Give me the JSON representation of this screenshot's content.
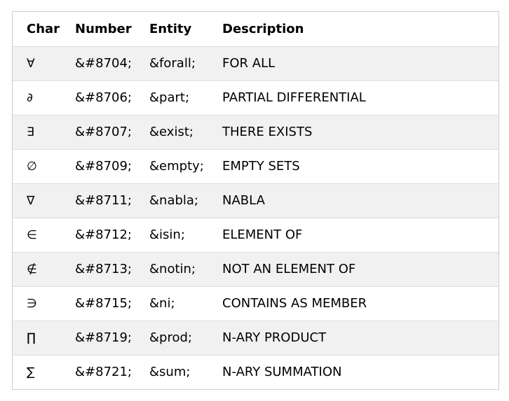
{
  "table": {
    "headers": [
      "Char",
      "Number",
      "Entity",
      "Description"
    ],
    "rows": [
      {
        "char": "∀",
        "number": "&#8704;",
        "entity": "&forall;",
        "description": "FOR ALL"
      },
      {
        "char": "∂",
        "number": "&#8706;",
        "entity": "&part;",
        "description": "PARTIAL DIFFERENTIAL"
      },
      {
        "char": "∃",
        "number": "&#8707;",
        "entity": "&exist;",
        "description": "THERE EXISTS"
      },
      {
        "char": "∅",
        "number": "&#8709;",
        "entity": "&empty;",
        "description": "EMPTY SETS"
      },
      {
        "char": "∇",
        "number": "&#8711;",
        "entity": "&nabla;",
        "description": "NABLA"
      },
      {
        "char": "∈",
        "number": "&#8712;",
        "entity": "&isin;",
        "description": "ELEMENT OF"
      },
      {
        "char": "∉",
        "number": "&#8713;",
        "entity": "&notin;",
        "description": "NOT AN ELEMENT OF"
      },
      {
        "char": "∋",
        "number": "&#8715;",
        "entity": "&ni;",
        "description": "CONTAINS AS MEMBER"
      },
      {
        "char": "∏",
        "number": "&#8719;",
        "entity": "&prod;",
        "description": "N-ARY PRODUCT"
      },
      {
        "char": "∑",
        "number": "&#8721;",
        "entity": "&sum;",
        "description": "N-ARY SUMMATION"
      }
    ]
  }
}
